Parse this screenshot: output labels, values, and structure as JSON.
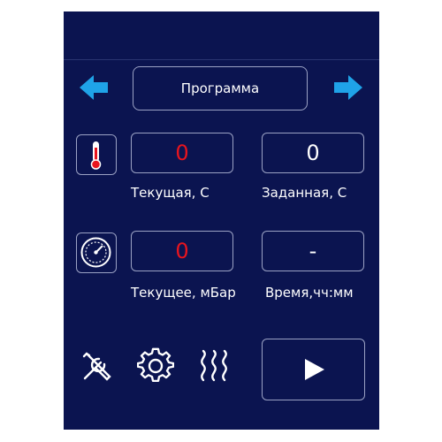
{
  "header": {
    "title": "Программа"
  },
  "temperature": {
    "current_value": "0",
    "current_label": "Текущая, С",
    "set_value": "0",
    "set_label": "Заданная, С"
  },
  "pressure": {
    "current_value": "0",
    "current_label": "Текущее, мБар",
    "time_value": "-",
    "time_label": "Время,чч:мм"
  },
  "icons": {
    "prev": "left-arrow-icon",
    "next": "right-arrow-icon",
    "thermometer": "thermometer-icon",
    "gauge": "gauge-icon",
    "tools": "tools-icon",
    "settings": "gear-icon",
    "heat": "heat-icon",
    "play": "play-icon"
  },
  "colors": {
    "background": "#0b1450",
    "accent": "#1fa3e8",
    "alert_value": "#e8141e",
    "border": "#9ba2c4"
  }
}
